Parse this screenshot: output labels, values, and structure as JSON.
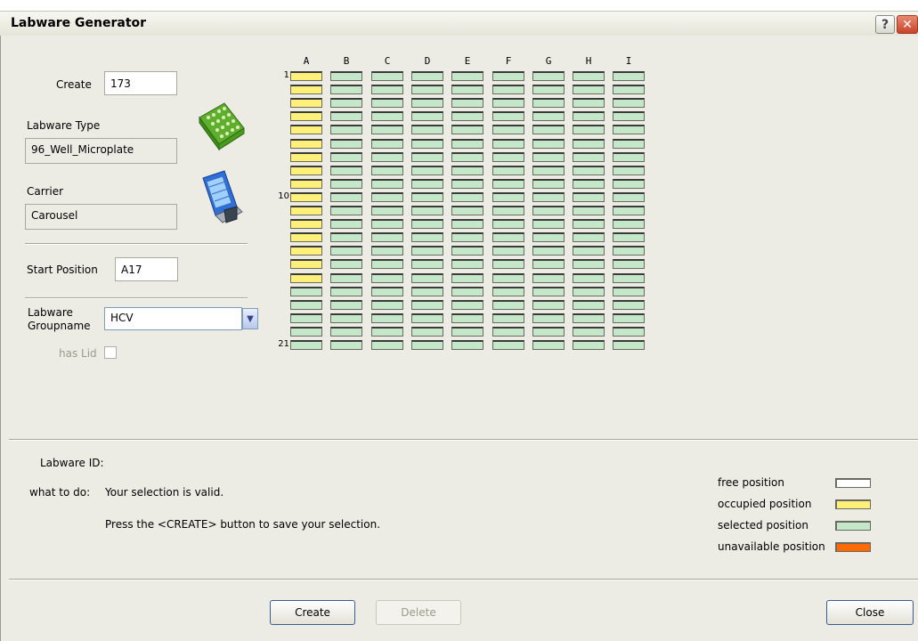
{
  "window": {
    "title": "Labware Generator"
  },
  "form": {
    "create_label": "Create",
    "create_value": "173",
    "labware_type_label": "Labware Type",
    "labware_type_value": "96_Well_Microplate",
    "carrier_label": "Carrier",
    "carrier_value": "Carousel",
    "start_position_label": "Start Position",
    "start_position_value": "A17",
    "groupname_label_line1": "Labware",
    "groupname_label_line2": "Groupname",
    "groupname_value": "HCV",
    "has_lid_label": "has Lid",
    "has_lid_checked": false,
    "labware_icon": "microplate-icon",
    "carrier_icon": "carousel-icon"
  },
  "grid": {
    "columns": [
      "A",
      "B",
      "C",
      "D",
      "E",
      "F",
      "G",
      "H",
      "I"
    ],
    "row_count": 21,
    "row_labels": {
      "1": "1",
      "10": "10",
      "21": "21"
    },
    "occupied": {
      "column": "A",
      "rows": [
        1,
        2,
        3,
        4,
        5,
        6,
        7,
        8,
        9,
        10,
        11,
        12,
        13,
        14,
        15,
        16
      ]
    },
    "selected_columns": [
      "A",
      "B",
      "C",
      "D",
      "E",
      "F",
      "G",
      "H",
      "I"
    ]
  },
  "info": {
    "labware_id_label": "Labware ID:",
    "labware_id_value": "",
    "what_to_do_label": "what to do:",
    "message_line1": "Your selection is valid.",
    "message_line2": "Press the <CREATE> button to save your selection."
  },
  "legend": [
    {
      "label": "free position",
      "color": "#ffffff"
    },
    {
      "label": "occupied position",
      "color": "#fff07a"
    },
    {
      "label": "selected position",
      "color": "#c4e6c9"
    },
    {
      "label": "unavailable position",
      "color": "#ff6a00"
    }
  ],
  "buttons": {
    "create": "Create",
    "delete": "Delete",
    "close": "Close"
  },
  "colors": {
    "occupied": "#fff07a",
    "selected": "#c4e6c9",
    "free": "#ffffff",
    "unavailable": "#ff6a00"
  }
}
